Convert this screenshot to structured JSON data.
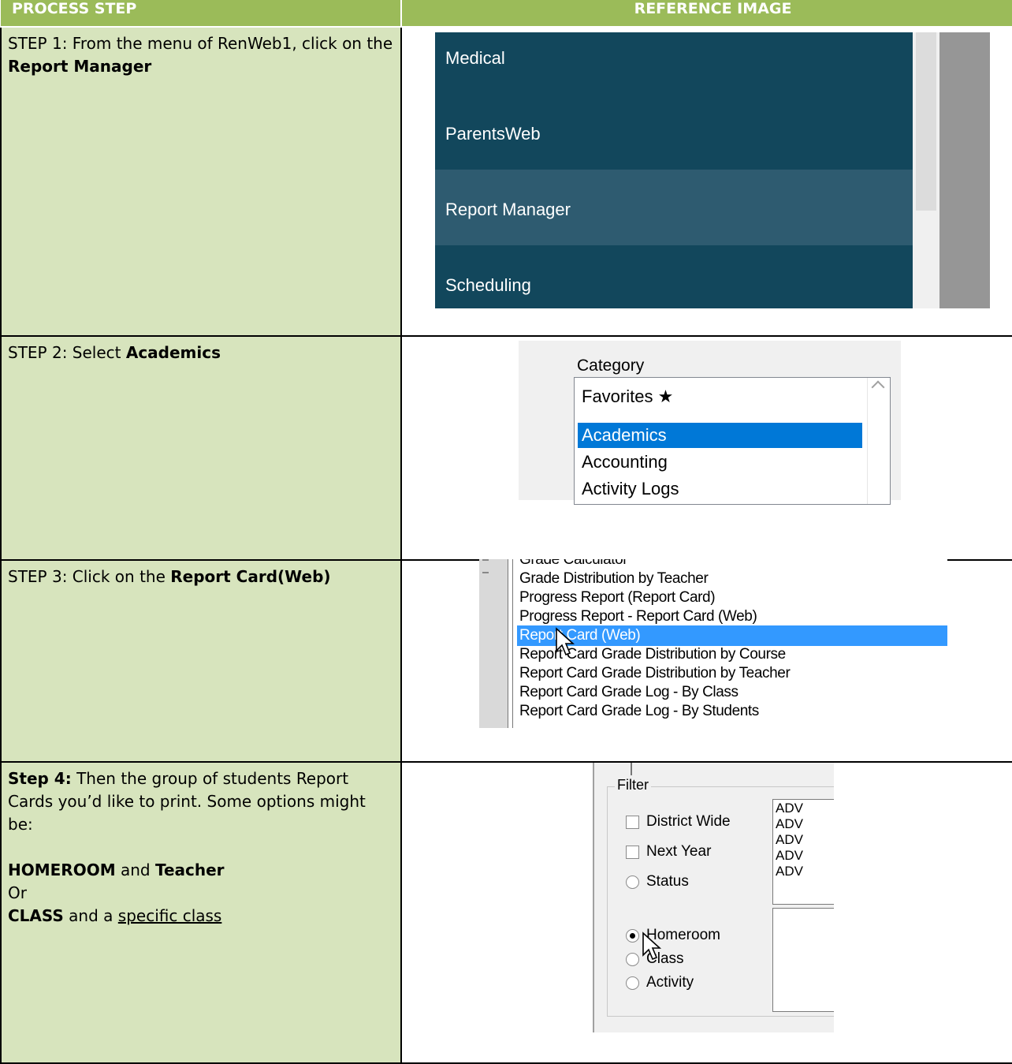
{
  "header": {
    "col1": "PROCESS STEP",
    "col2": "REFERENCE IMAGE"
  },
  "steps": [
    {
      "prefix": "STEP 1: From the menu of RenWeb1, click on the ",
      "bold": "Report Manager",
      "menu": {
        "items": [
          "Medical",
          "ParentsWeb",
          "Report Manager",
          "Scheduling"
        ],
        "selected": "Report Manager"
      }
    },
    {
      "prefix": "STEP 2: Select ",
      "bold": "Academics",
      "category": {
        "label": "Category",
        "items": [
          "Favorites ★",
          "Academics",
          "Accounting",
          "Activity Logs"
        ],
        "selected": "Academics"
      }
    },
    {
      "prefix": "STEP 3: Click on the ",
      "bold": "Report Card(Web)",
      "reports": {
        "items": [
          "Grade Calculator",
          "Grade Distribution by Teacher",
          "Progress Report (Report Card)",
          "Progress Report - Report Card (Web)",
          "Report Card (Web)",
          "Report Card Grade Distribution by Course",
          "Report Card Grade Distribution by Teacher",
          "Report Card Grade Log - By Class",
          "Report Card Grade Log - By Students"
        ],
        "selected": "Report Card (Web)"
      }
    },
    {
      "lead_bold": "Step 4:",
      "line1": " Then the group of students Report Cards you’d like to print. Some options might be:",
      "opt1_bold_a": "HOMEROOM",
      "opt1_mid": " and ",
      "opt1_bold_b": "Teacher",
      "or": "Or",
      "opt2_bold": "CLASS",
      "opt2_mid": " and a ",
      "opt2_underline": "specific class",
      "filter": {
        "legend": "Filter",
        "district_wide": "District Wide",
        "next_year": "Next Year",
        "status": "Status",
        "homeroom": "Homeroom",
        "class": "Class",
        "activity": "Activity",
        "list_items": [
          "ADV",
          "ADV",
          "ADV",
          "ADV",
          "ADV"
        ]
      }
    }
  ]
}
